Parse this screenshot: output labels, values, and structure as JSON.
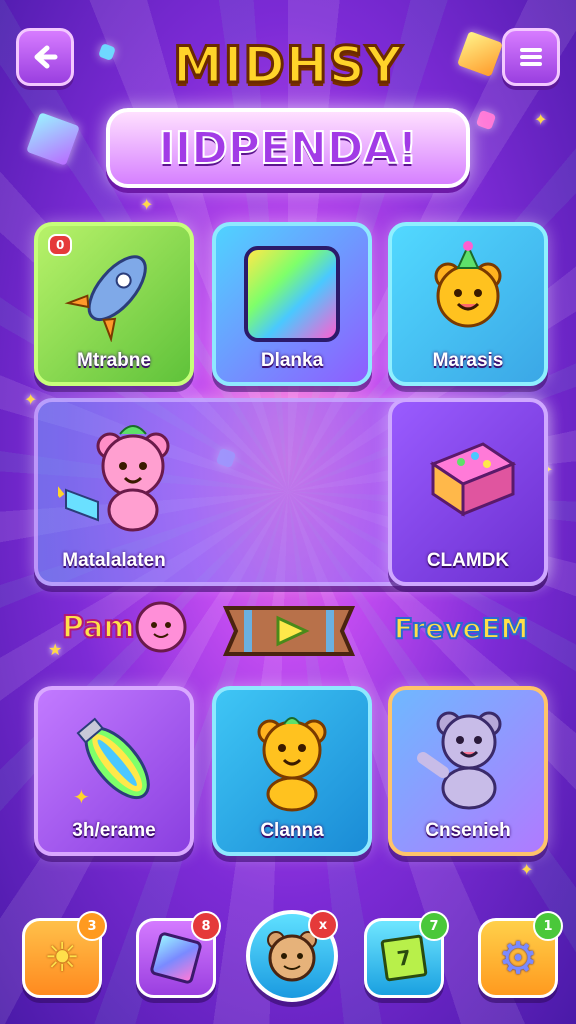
{
  "header": {
    "back_icon": "arrow-left-icon",
    "menu_icon": "hamburger-menu-icon",
    "title": "MIDHSY",
    "banner": "IIDPENDA!"
  },
  "grid_top": [
    {
      "label": "Mtrabne",
      "icon": "rocket-icon",
      "badge": "0"
    },
    {
      "label": "Dlanka",
      "icon": "rainbow-square-icon"
    },
    {
      "label": "Marasis",
      "icon": "party-bear-icon"
    }
  ],
  "grid_middle": [
    {
      "label": "Matalalaten",
      "icon": "pink-bear-icon"
    },
    {
      "label": "CLAMDK",
      "icon": "gift-box-icon"
    }
  ],
  "middle_row": {
    "left_text": "Pam",
    "play_icon": "play-icon",
    "right_text": "FreveEM"
  },
  "grid_bottom": [
    {
      "label": "3h/erame",
      "icon": "rainbow-rocket-icon"
    },
    {
      "label": "Clanna",
      "icon": "orange-bear-icon"
    },
    {
      "label": "Cnsenieh",
      "icon": "gray-bear-icon"
    }
  ],
  "bottom_nav": [
    {
      "icon": "sun-icon",
      "badge": "3",
      "color": "#ff9a1f"
    },
    {
      "icon": "crystal-icon",
      "badge": "8",
      "color": "#b44bff"
    },
    {
      "icon": "bear-face-icon",
      "badge": "x",
      "color": "#29c7f0"
    },
    {
      "icon": "green-card-icon",
      "badge": "7",
      "color": "#29c7f0"
    },
    {
      "icon": "gear-icon",
      "badge": "1",
      "color": "#ffb21f"
    }
  ],
  "colors": {
    "accent_yellow": "#ffd42a",
    "accent_purple": "#a23be6",
    "tile_green": "#8be04a",
    "tile_blue": "#3cc6f5",
    "tile_purple": "#c06af5"
  }
}
